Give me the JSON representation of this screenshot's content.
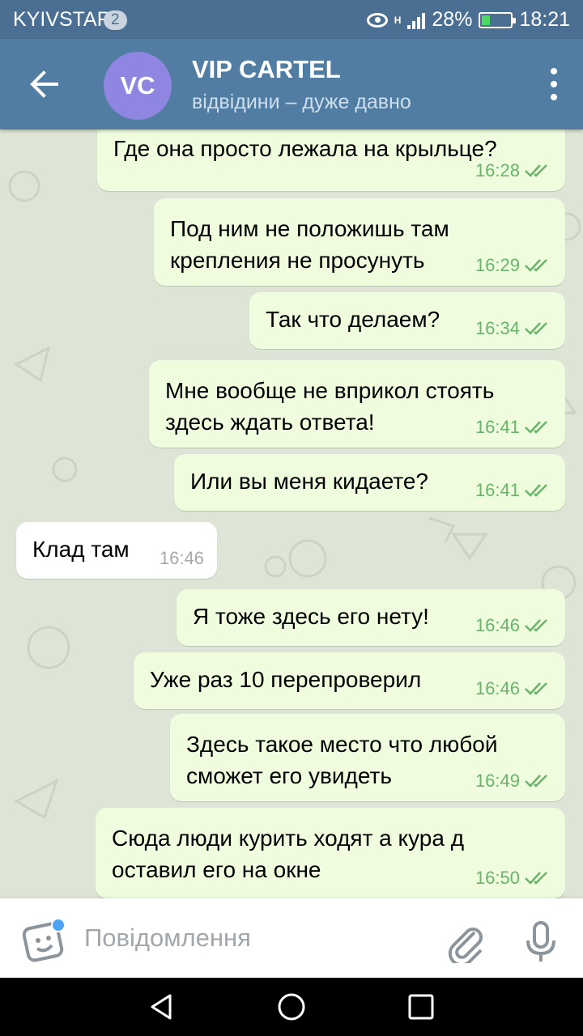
{
  "status_bar": {
    "carrier": "KYIVSTAR",
    "sim_badge": "2",
    "network": "H",
    "battery": "28%",
    "battery_level": 0.28,
    "time": "18:21"
  },
  "header": {
    "avatar_initials": "VC",
    "avatar_color": "#8e86e1",
    "title": "VIP CARTEL",
    "status": "відвідини – дуже давно"
  },
  "messages": [
    {
      "direction": "out",
      "lines": [
        "Где она просто лежала на крыльце?"
      ],
      "time": "16:28",
      "read": true
    },
    {
      "direction": "out",
      "lines": [
        "Под ним не положишь там",
        "крепления не просунуть"
      ],
      "time": "16:29",
      "read": true
    },
    {
      "direction": "out",
      "lines": [
        "Так что делаем?"
      ],
      "time": "16:34",
      "read": true
    },
    {
      "direction": "out",
      "lines": [
        "Мне вообще не вприкол стоять",
        "здесь ждать ответа!"
      ],
      "time": "16:41",
      "read": true
    },
    {
      "direction": "out",
      "lines": [
        "Или вы меня кидаете?"
      ],
      "time": "16:41",
      "read": true
    },
    {
      "direction": "in",
      "lines": [
        "Клад там"
      ],
      "time": "16:46"
    },
    {
      "direction": "out",
      "lines": [
        "Я тоже здесь его нету!"
      ],
      "time": "16:46",
      "read": true
    },
    {
      "direction": "out",
      "lines": [
        "Уже раз 10 перепроверил"
      ],
      "time": "16:46",
      "read": true
    },
    {
      "direction": "out",
      "lines": [
        "Здесь такое место что любой",
        "сможет его увидеть"
      ],
      "time": "16:49",
      "read": true
    },
    {
      "direction": "out",
      "lines": [
        "Сюда люди курить ходят а кура д",
        "оставил его на окне"
      ],
      "time": "16:50",
      "read": true
    }
  ],
  "composer": {
    "placeholder": "Повідомлення"
  },
  "colors": {
    "header": "#517da2",
    "statusbar": "#4a6f93",
    "outgoing_bubble": "#effdde",
    "incoming_bubble": "#ffffff",
    "read_ticks": "#6ab36a"
  }
}
